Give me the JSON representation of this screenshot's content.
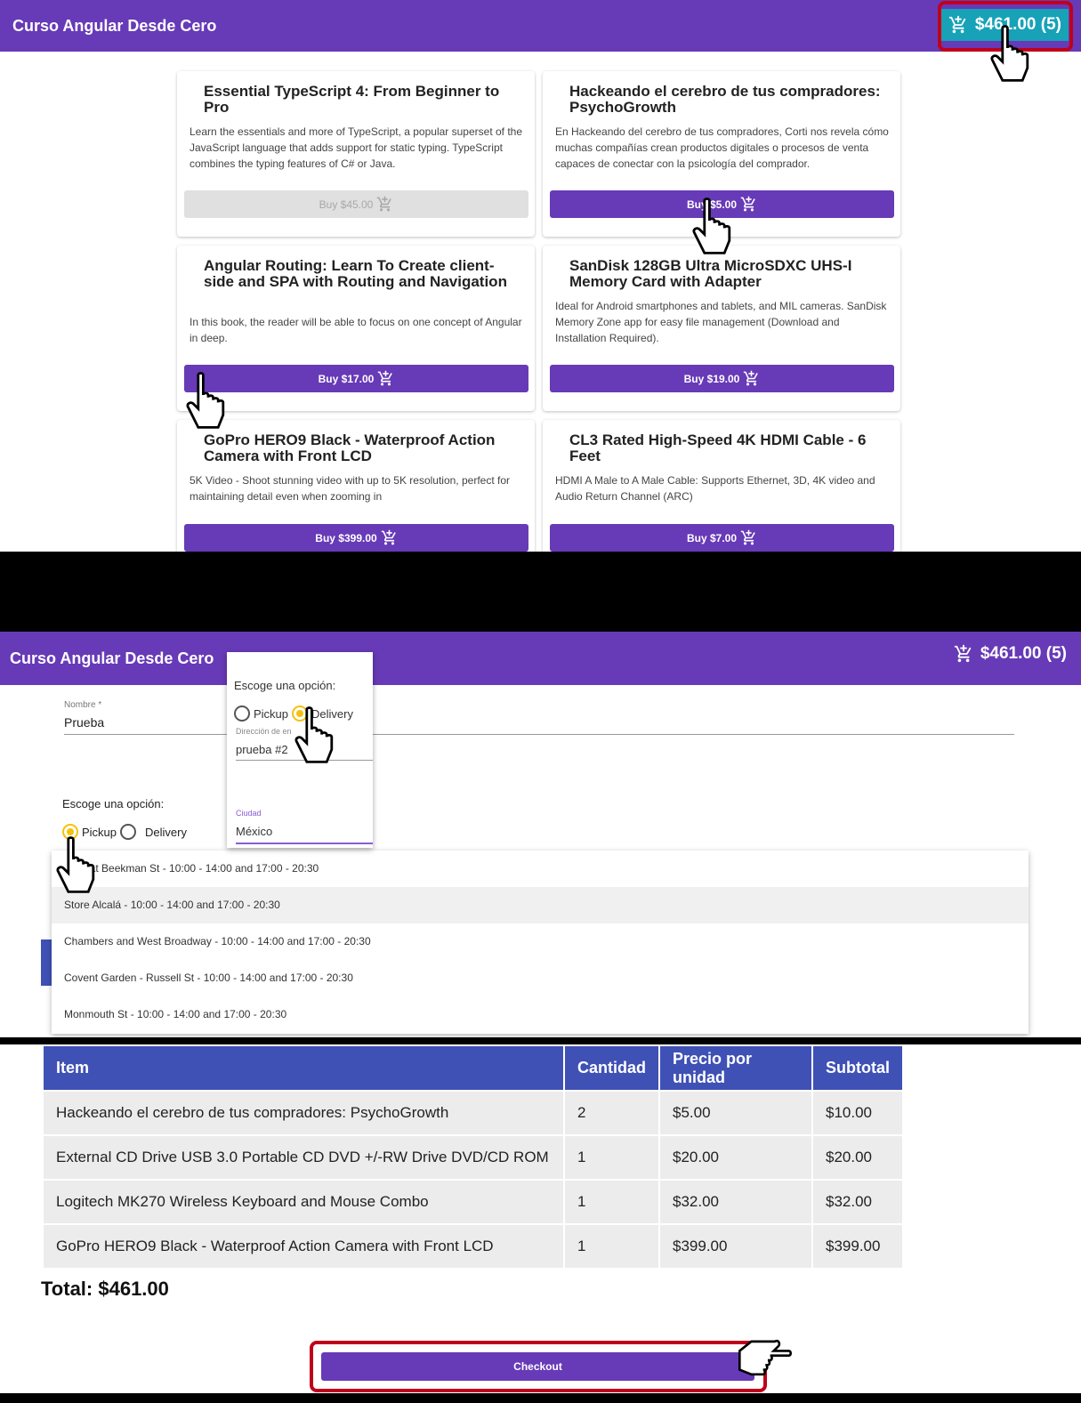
{
  "app": {
    "title": "Curso Angular Desde Cero"
  },
  "cart": {
    "label": "$461.00 (5)",
    "label_partial": "$4",
    "label_tail": ".00 (5)"
  },
  "products": [
    {
      "title": "Essential TypeScript 4: From Beginner to Pro",
      "description": "Learn the essentials and more of TypeScript, a popular superset of the JavaScript language that adds support for static typing. TypeScript combines the typing features of C# or Java.",
      "buy_label": "Buy $45.00",
      "disabled": true
    },
    {
      "title": "Hackeando el cerebro de tus compradores: PsychoGrowth",
      "description": "En Hackeando del cerebro de tus compradores, Corti nos revela cómo muchas compañías crean productos digitales o procesos de venta capaces de conectar con la psicología del comprador.",
      "buy_label": "Buy $5.00",
      "disabled": false
    },
    {
      "title": "Angular Routing: Learn To Create client-side and SPA with Routing and Navigation",
      "description": "In this book, the reader will be able to focus on one concept of Angular in deep.",
      "buy_label": "Buy $17.00",
      "disabled": false
    },
    {
      "title": "SanDisk 128GB Ultra MicroSDXC UHS-I Memory Card with Adapter",
      "description": "Ideal for Android smartphones and tablets, and MIL cameras. SanDisk Memory Zone app for easy file management (Download and Installation Required).",
      "buy_label": "Buy $19.00",
      "disabled": false
    },
    {
      "title": "GoPro HERO9 Black - Waterproof Action Camera with Front LCD",
      "description": "5K Video - Shoot stunning video with up to 5K resolution, perfect for maintaining detail even when zooming in",
      "buy_label": "Buy $399.00",
      "disabled": false
    },
    {
      "title": "CL3 Rated High-Speed 4K HDMI Cable - 6 Feet",
      "description": "HDMI A Male to A Male Cable: Supports Ethernet, 3D, 4K video and Audio Return Channel (ARC)",
      "buy_label": "Buy $7.00",
      "disabled": false
    }
  ],
  "checkout_form": {
    "name_label": "Nombre *",
    "name_value": "Prueba",
    "option_label": "Escoge una opción:",
    "pickup_label": "Pickup",
    "delivery_label": "Delivery",
    "stores": [
      "...ow at Beekman St - 10:00 - 14:00 and 17:00 - 20:30",
      "Store Alcalá - 10:00 - 14:00 and 17:00 - 20:30",
      "Chambers and West Broadway - 10:00 - 14:00 and 17:00 - 20:30",
      "Covent Garden - Russell St - 10:00 - 14:00 and 17:00 - 20:30",
      "Monmouth St - 10:00 - 14:00 and 17:00 - 20:30"
    ],
    "zoom": {
      "option_label": "Escoge una opción:",
      "pickup_label": "Pickup",
      "delivery_label": "Delivery",
      "address_label": "Dirección de en",
      "address_value": "prueba #2",
      "city_label": "Ciudad",
      "city_value": "México"
    }
  },
  "summary": {
    "headers": [
      "Item",
      "Cantidad",
      "Precio por unidad",
      "Subtotal"
    ],
    "rows": [
      [
        "Hackeando el cerebro de tus compradores: PsychoGrowth",
        "2",
        "$5.00",
        "$10.00"
      ],
      [
        "External CD Drive USB 3.0 Portable CD DVD +/-RW Drive DVD/CD ROM",
        "1",
        "$20.00",
        "$20.00"
      ],
      [
        "Logitech MK270 Wireless Keyboard and Mouse Combo",
        "1",
        "$32.00",
        "$32.00"
      ],
      [
        "GoPro HERO9 Black - Waterproof Action Camera with Front LCD",
        "1",
        "$399.00",
        "$399.00"
      ]
    ],
    "total": "Total: $461.00",
    "checkout_label": "Checkout"
  },
  "icons": {
    "cart": "cart-plus-icon",
    "cursor": "hand-pointer-icon"
  },
  "colors": {
    "primary": "#673ab7",
    "accent": "#17a2b8",
    "table_header": "#3f51b5",
    "highlight": "#c0001a",
    "radio_checked": "#f4c20d"
  }
}
